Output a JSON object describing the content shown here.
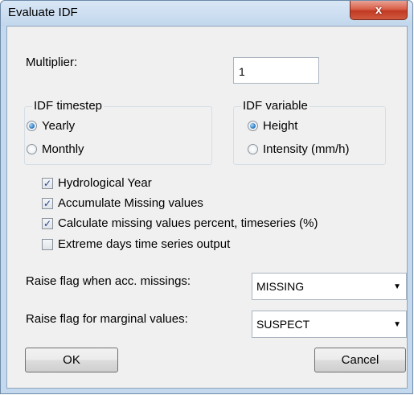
{
  "window": {
    "title": "Evaluate IDF",
    "close_icon_glyph": "x"
  },
  "multiplier": {
    "label": "Multiplier:",
    "value": "1"
  },
  "idf_timestep": {
    "legend": "IDF timestep",
    "options": [
      {
        "label": "Yearly",
        "selected": true
      },
      {
        "label": "Monthly",
        "selected": false
      }
    ]
  },
  "idf_variable": {
    "legend": "IDF variable",
    "options": [
      {
        "label": "Height",
        "selected": true
      },
      {
        "label": "Intensity (mm/h)",
        "selected": false
      }
    ]
  },
  "checkboxes": [
    {
      "label": "Hydrological Year",
      "checked": true
    },
    {
      "label": "Accumulate Missing values",
      "checked": true
    },
    {
      "label": "Calculate missing values percent, timeseries (%)",
      "checked": true
    },
    {
      "label": "Extreme days time series output",
      "checked": false
    }
  ],
  "flags": {
    "acc_missings": {
      "label": "Raise flag when acc. missings:",
      "value": "MISSING"
    },
    "marginal": {
      "label": "Raise flag for marginal values:",
      "value": "SUSPECT"
    }
  },
  "buttons": {
    "ok": "OK",
    "cancel": "Cancel"
  },
  "colors": {
    "titlebar": "#c2d7ec",
    "close_button": "#c13a23",
    "client_bg": "#f0f0f0",
    "radio_selected": "#2f7fc9"
  }
}
